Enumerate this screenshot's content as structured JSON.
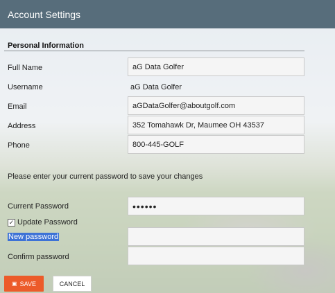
{
  "header": {
    "title": "Account Settings"
  },
  "personal_info": {
    "section_title": "Personal Information",
    "full_name": {
      "label": "Full Name",
      "value": "aG Data Golfer"
    },
    "username": {
      "label": "Username",
      "value": "aG Data Golfer"
    },
    "email": {
      "label": "Email",
      "value": "aGDataGolfer@aboutgolf.com"
    },
    "address": {
      "label": "Address",
      "value": "352 Tomahawk Dr, Maumee OH 43537"
    },
    "phone": {
      "label": "Phone",
      "value": "800-445-GOLF"
    }
  },
  "password": {
    "note": "Please enter your current password to save your changes",
    "current": {
      "label": "Current Password",
      "value": "••••••"
    },
    "update_checkbox": {
      "label": "Update Password",
      "checked": true,
      "mark": "✓"
    },
    "new": {
      "label": "New password",
      "value": ""
    },
    "confirm": {
      "label": "Confirm password",
      "value": ""
    }
  },
  "buttons": {
    "save": "SAVE",
    "save_icon": "floppy-disk-icon",
    "cancel": "CANCEL"
  },
  "colors": {
    "header": "#576d7b",
    "save": "#ec5b2a",
    "selection": "#3d72d6"
  }
}
